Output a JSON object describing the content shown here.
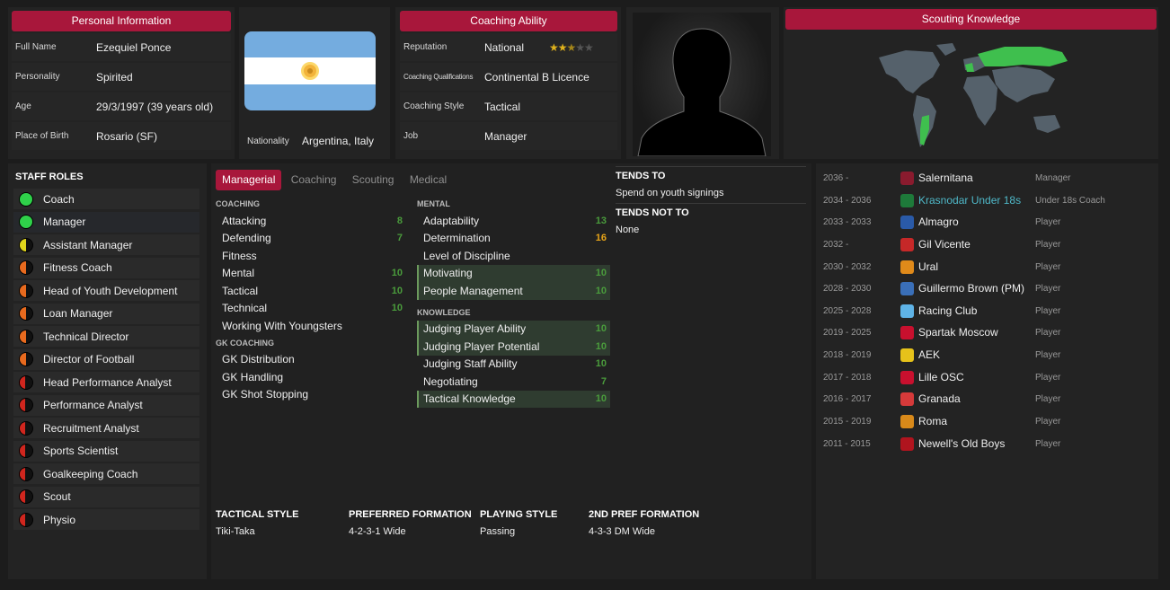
{
  "personal": {
    "title": "Personal Information",
    "fields": [
      {
        "label": "Full Name",
        "value": "Ezequiel Ponce"
      },
      {
        "label": "Personality",
        "value": "Spirited"
      },
      {
        "label": "Age",
        "value": "29/3/1997 (39 years old)"
      },
      {
        "label": "Place of Birth",
        "value": "Rosario (SF)"
      }
    ]
  },
  "nationality": {
    "label": "Nationality",
    "value": "Argentina, Italy"
  },
  "coaching_ability": {
    "title": "Coaching Ability",
    "fields": [
      {
        "label": "Reputation",
        "value": "National"
      },
      {
        "label": "Coaching Qualifications",
        "value": "Continental B Licence"
      },
      {
        "label": "Coaching Style",
        "value": "Tactical"
      },
      {
        "label": "Job",
        "value": "Manager"
      }
    ],
    "reputation_stars": 2.5,
    "reputation_stars_max": 5
  },
  "scouting": {
    "title": "Scouting Knowledge"
  },
  "staff_roles": {
    "title": "STAFF ROLES",
    "items": [
      {
        "label": "Coach",
        "suitability": 1.0,
        "color": "#2fd14a"
      },
      {
        "label": "Manager",
        "suitability": 1.0,
        "color": "#2fd14a"
      },
      {
        "label": "Assistant Manager",
        "suitability": 0.5,
        "color": "#e0d51c"
      },
      {
        "label": "Fitness Coach",
        "suitability": 0.5,
        "color": "#e86a1e"
      },
      {
        "label": "Head of Youth Development",
        "suitability": 0.5,
        "color": "#e86a1e"
      },
      {
        "label": "Loan Manager",
        "suitability": 0.5,
        "color": "#e86a1e"
      },
      {
        "label": "Technical Director",
        "suitability": 0.5,
        "color": "#e86a1e"
      },
      {
        "label": "Director of Football",
        "suitability": 0.5,
        "color": "#e86a1e"
      },
      {
        "label": "Head Performance Analyst",
        "suitability": 0.4,
        "color": "#d0261e"
      },
      {
        "label": "Performance Analyst",
        "suitability": 0.4,
        "color": "#d0261e"
      },
      {
        "label": "Recruitment Analyst",
        "suitability": 0.4,
        "color": "#d0261e"
      },
      {
        "label": "Sports Scientist",
        "suitability": 0.4,
        "color": "#d0261e"
      },
      {
        "label": "Goalkeeping Coach",
        "suitability": 0.4,
        "color": "#d0261e"
      },
      {
        "label": "Scout",
        "suitability": 0.4,
        "color": "#d0261e"
      },
      {
        "label": "Physio",
        "suitability": 0.4,
        "color": "#d0261e"
      }
    ]
  },
  "tabs": [
    "Managerial",
    "Coaching",
    "Scouting",
    "Medical"
  ],
  "attributes": {
    "coaching_header": "COACHING",
    "coaching": [
      {
        "label": "Attacking",
        "value": "8"
      },
      {
        "label": "Defending",
        "value": "7"
      },
      {
        "label": "Fitness",
        "value": ""
      },
      {
        "label": "Mental",
        "value": "10"
      },
      {
        "label": "Tactical",
        "value": "10"
      },
      {
        "label": "Technical",
        "value": "10"
      },
      {
        "label": "Working With Youngsters",
        "value": ""
      }
    ],
    "gk_header": "GK COACHING",
    "gk": [
      {
        "label": "GK Distribution",
        "value": ""
      },
      {
        "label": "GK Handling",
        "value": ""
      },
      {
        "label": "GK Shot Stopping",
        "value": ""
      }
    ],
    "mental_header": "MENTAL",
    "mental": [
      {
        "label": "Adaptability",
        "value": "13",
        "hl": false,
        "yellow": false
      },
      {
        "label": "Determination",
        "value": "16",
        "hl": false,
        "yellow": true
      },
      {
        "label": "Level of Discipline",
        "value": "",
        "hl": false,
        "yellow": false
      },
      {
        "label": "Motivating",
        "value": "10",
        "hl": true,
        "yellow": false
      },
      {
        "label": "People Management",
        "value": "10",
        "hl": true,
        "yellow": false
      }
    ],
    "knowledge_header": "KNOWLEDGE",
    "knowledge": [
      {
        "label": "Judging Player Ability",
        "value": "10",
        "hl": true
      },
      {
        "label": "Judging Player Potential",
        "value": "10",
        "hl": true
      },
      {
        "label": "Judging Staff Ability",
        "value": "10",
        "hl": false
      },
      {
        "label": "Negotiating",
        "value": "7",
        "hl": false
      },
      {
        "label": "Tactical Knowledge",
        "value": "10",
        "hl": true
      }
    ]
  },
  "tends": {
    "to_title": "TENDS TO",
    "to_value": "Spend on youth signings",
    "not_title": "TENDS NOT TO",
    "not_value": "None"
  },
  "styles": [
    {
      "label": "TACTICAL STYLE",
      "value": "Tiki-Taka"
    },
    {
      "label": "PREFERRED FORMATION",
      "value": "4-2-3-1 Wide"
    },
    {
      "label": "PLAYING STYLE",
      "value": "Passing"
    },
    {
      "label": "2ND PREF FORMATION",
      "value": "4-3-3 DM Wide"
    }
  ],
  "career": [
    {
      "years": "2036 -",
      "club": "Salernitana",
      "role": "Manager",
      "color": "#8a1b2e",
      "link": false
    },
    {
      "years": "2034 - 2036",
      "club": "Krasnodar Under 18s",
      "role": "Under 18s Coach",
      "color": "#1e7a3a",
      "link": true
    },
    {
      "years": "2033 - 2033",
      "club": "Almagro",
      "role": "Player",
      "color": "#2a5aa8",
      "link": false
    },
    {
      "years": "2032 -",
      "club": "Gil Vicente",
      "role": "Player",
      "color": "#c62828",
      "link": false
    },
    {
      "years": "2030 - 2032",
      "club": "Ural",
      "role": "Player",
      "color": "#e08a1a",
      "link": false
    },
    {
      "years": "2028 - 2030",
      "club": "Guillermo Brown (PM)",
      "role": "Player",
      "color": "#3a6fb8",
      "link": false
    },
    {
      "years": "2025 - 2028",
      "club": "Racing Club",
      "role": "Player",
      "color": "#5fb3e6",
      "link": false
    },
    {
      "years": "2019 - 2025",
      "club": "Spartak Moscow",
      "role": "Player",
      "color": "#c8102e",
      "link": false
    },
    {
      "years": "2018 - 2019",
      "club": "AEK",
      "role": "Player",
      "color": "#e6c21a",
      "link": false
    },
    {
      "years": "2017 - 2018",
      "club": "Lille OSC",
      "role": "Player",
      "color": "#c8102e",
      "link": false
    },
    {
      "years": "2016 - 2017",
      "club": "Granada",
      "role": "Player",
      "color": "#d63a3a",
      "link": false
    },
    {
      "years": "2015 - 2019",
      "club": "Roma",
      "role": "Player",
      "color": "#d98a1a",
      "link": false
    },
    {
      "years": "2011 - 2015",
      "club": "Newell's Old Boys",
      "role": "Player",
      "color": "#b0141e",
      "link": false
    }
  ]
}
